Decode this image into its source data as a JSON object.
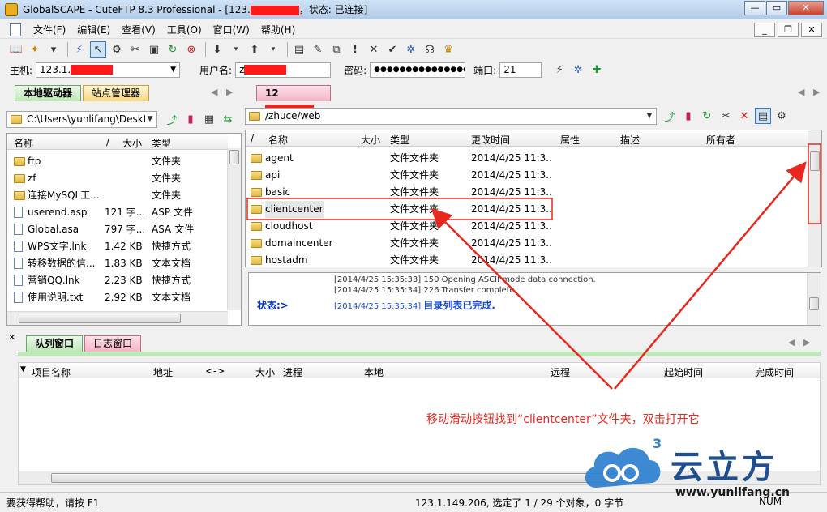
{
  "window": {
    "title": "GlobalSCAPE - CuteFTP 8.3 Professional - [123.",
    "title_suffix": "，状态: 已连接]",
    "min": "—",
    "max": "▭",
    "close": "✕"
  },
  "menu": [
    "文件(F)",
    "编辑(E)",
    "查看(V)",
    "工具(O)",
    "窗口(W)",
    "帮助(H)"
  ],
  "connection": {
    "host_label": "主机:",
    "host_value": "123.1.",
    "user_label": "用户名:",
    "user_value": "z",
    "pass_label": "密码:",
    "pass_value": "●●●●●●●●●●●●●●●",
    "port_label": "端口:",
    "port_value": "21"
  },
  "left_tabs": [
    "本地驱动器",
    "站点管理器"
  ],
  "right_tab": "12",
  "left_path": "C:\\Users\\yunlifang\\Deskt",
  "right_path": "/zhuce/web",
  "left_headers": {
    "name": "名称",
    "sort": "/",
    "size": "大小",
    "type": "类型"
  },
  "left_files": [
    {
      "name": "ftp",
      "size": "",
      "type": "文件夹",
      "kind": "folder"
    },
    {
      "name": "zf",
      "size": "",
      "type": "文件夹",
      "kind": "folder"
    },
    {
      "name": "连接MySQL工...",
      "size": "",
      "type": "文件夹",
      "kind": "folder"
    },
    {
      "name": "userend.asp",
      "size": "121 字...",
      "type": "ASP 文件",
      "kind": "file"
    },
    {
      "name": "Global.asa",
      "size": "797 字...",
      "type": "ASA 文件",
      "kind": "file"
    },
    {
      "name": "WPS文字.lnk",
      "size": "1.42 KB",
      "type": "快捷方式",
      "kind": "file"
    },
    {
      "name": "转移数据的信...",
      "size": "1.83 KB",
      "type": "文本文档",
      "kind": "file"
    },
    {
      "name": "营销QQ.lnk",
      "size": "2.23 KB",
      "type": "快捷方式",
      "kind": "file"
    },
    {
      "name": "使用说明.txt",
      "size": "2.92 KB",
      "type": "文本文档",
      "kind": "file"
    }
  ],
  "right_headers": {
    "sort": "/",
    "name": "名称",
    "size": "大小",
    "type": "类型",
    "mtime": "更改时间",
    "attr": "属性",
    "desc": "描述",
    "owner": "所有者"
  },
  "right_files": [
    {
      "name": "agent",
      "type": "文件文件夹",
      "mtime": "2014/4/25 11:3..."
    },
    {
      "name": "api",
      "type": "文件文件夹",
      "mtime": "2014/4/25 11:3..."
    },
    {
      "name": "basic",
      "type": "文件文件夹",
      "mtime": "2014/4/25 11:3..."
    },
    {
      "name": "clientcenter",
      "type": "文件文件夹",
      "mtime": "2014/4/25 11:3..."
    },
    {
      "name": "cloudhost",
      "type": "文件文件夹",
      "mtime": "2014/4/25 11:3..."
    },
    {
      "name": "domaincenter",
      "type": "文件文件夹",
      "mtime": "2014/4/25 11:3..."
    },
    {
      "name": "hostadm",
      "type": "文件文件夹",
      "mtime": "2014/4/25 11:3..."
    }
  ],
  "log": {
    "line1": "[2014/4/25 15:35:33] 150 Opening ASCII mode data connection.",
    "line2": "[2014/4/25 15:35:34] 226 Transfer complete",
    "line3_time": "[2014/4/25 15:35:34]",
    "line3_msg": "目录列表已完成.",
    "status": "状态:>"
  },
  "queue_tabs": [
    "队列窗口",
    "日志窗口"
  ],
  "queue_headers": [
    "项目名称",
    "地址",
    "<->",
    "大小",
    "进程",
    "本地",
    "远程",
    "起始时间",
    "完成时间"
  ],
  "statusbar": {
    "help": "要获得帮助，请按 F1",
    "info": "123.1.149.206, 选定了 1 / 29 个对象，0 字节",
    "num": "NUM"
  },
  "annotation": "移动滑动按钮找到“clientcenter”文件夹，双击打开它",
  "logo": {
    "brand": "云立方",
    "url": "www.yunlifang.cn",
    "sup": "3"
  },
  "colors": {
    "annotation": "#e8281f",
    "accent": "#1f4f8f"
  }
}
